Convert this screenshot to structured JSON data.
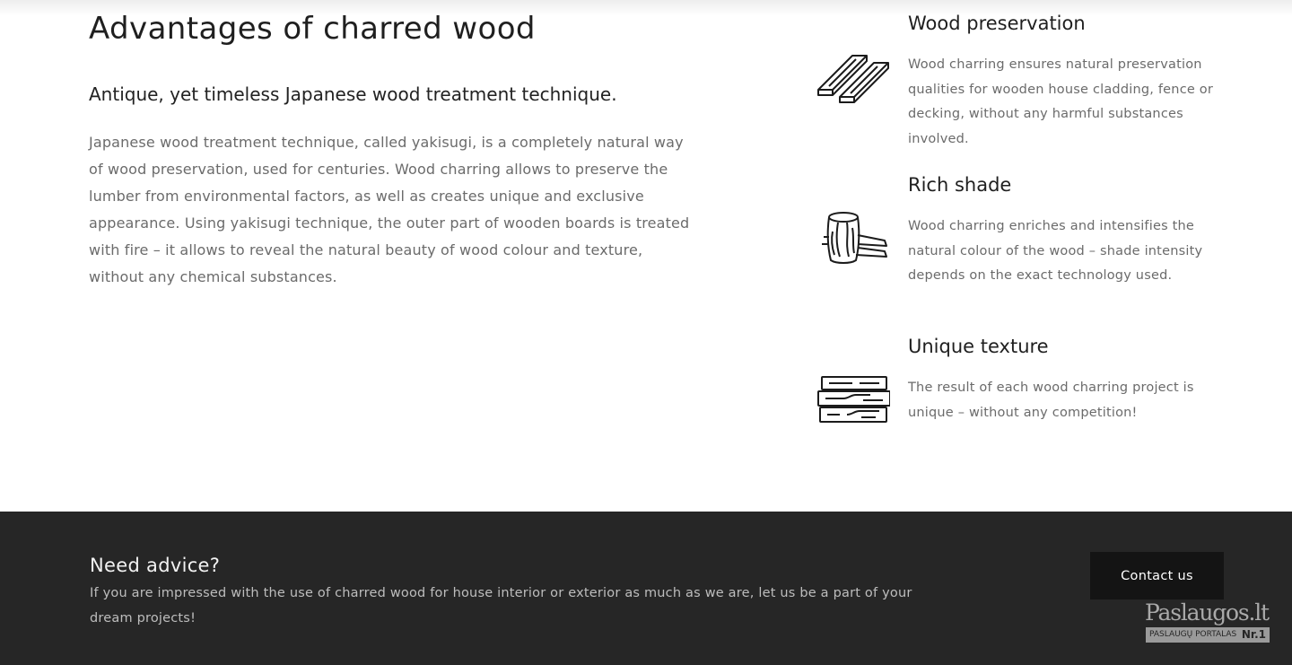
{
  "section": {
    "title": "Advantages of charred wood",
    "subtitle": "Antique, yet timeless Japanese wood treatment technique.",
    "body": "Japanese wood treatment technique, called yakisugi, is a completely natural way of wood preservation, used for centuries. Wood charring allows to preserve the lumber from environmental factors, as well as creates unique and exclusive appearance. Using yakisugi technique, the outer part of wooden boards is treated with fire – it allows to reveal the natural beauty of wood colour and texture, without any chemical substances."
  },
  "features": [
    {
      "icon": "wood-planks-icon",
      "title": "Wood preservation",
      "text": "Wood charring ensures natural preservation qualities for wooden house cladding, fence or decking, without any harmful substances involved."
    },
    {
      "icon": "wood-log-icon",
      "title": "Rich shade",
      "text": "Wood charring enriches and intensifies the natural colour of the wood – shade intensity depends on the exact technology used."
    },
    {
      "icon": "wood-stack-icon",
      "title": "Unique texture",
      "text": "The result of each wood charring project is unique – without any competition!"
    }
  ],
  "footer": {
    "heading": "Need advice?",
    "text": "If you are impressed with the use of charred wood for house interior or exterior as much as we are, let us be a part of your dream projects!",
    "button_label": "Contact us",
    "colors": {
      "background": "#262626",
      "button": "#141414"
    }
  },
  "badge": {
    "name": "Paslaugos.lt",
    "tagline": "PASLAUGŲ PORTALAS",
    "rank": "Nr.1"
  }
}
